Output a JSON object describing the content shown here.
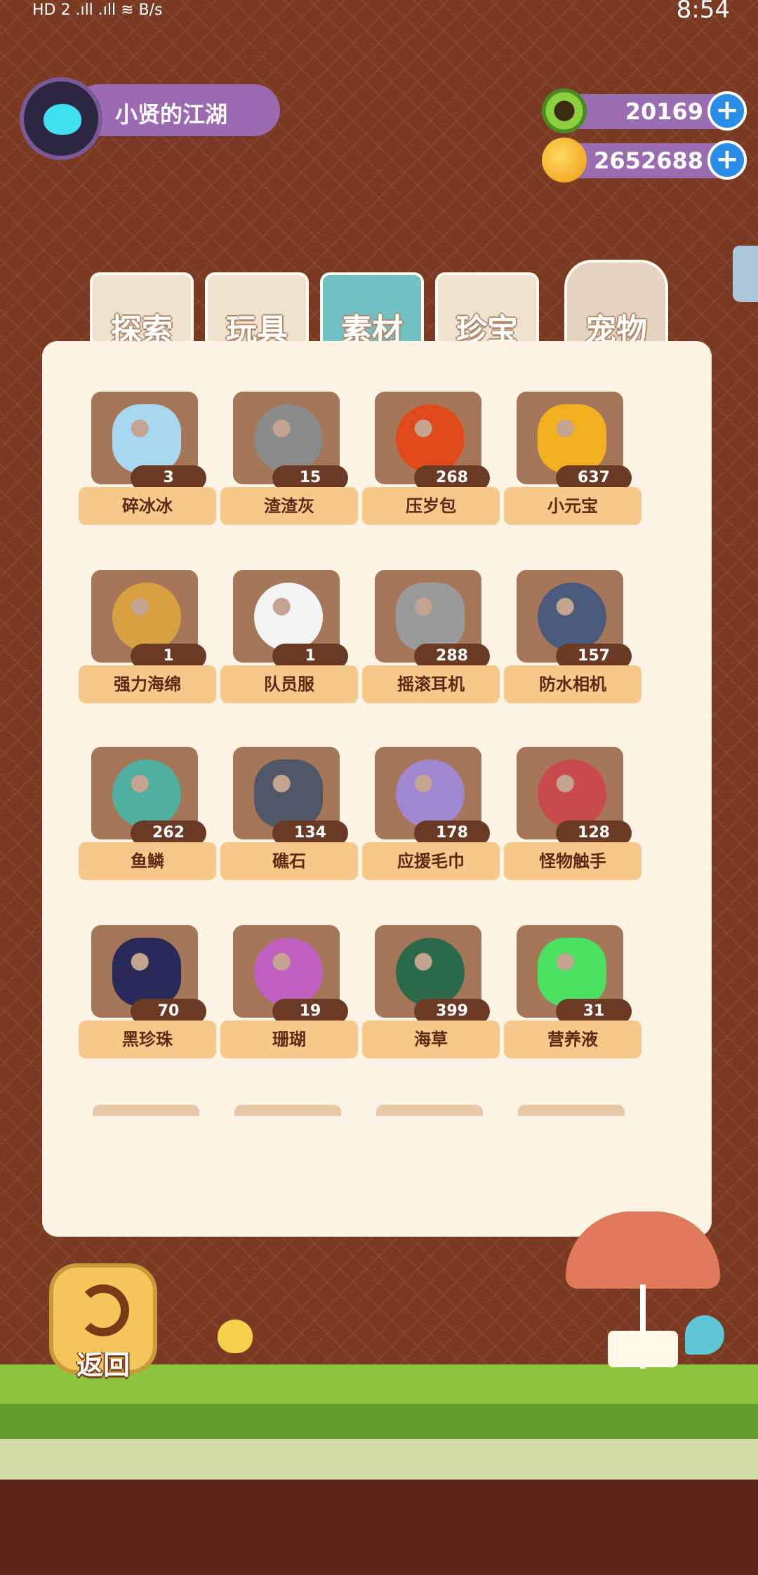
{
  "status_bar": {
    "left": "HD 2  .ıll  .ıll  ≋  B/s",
    "time": "8:54"
  },
  "profile": {
    "name": "小贤的江湖"
  },
  "currencies": [
    {
      "icon": "donut-icon",
      "value": "20169"
    },
    {
      "icon": "planet-coin-icon",
      "value": "2652688"
    }
  ],
  "tabs": [
    {
      "label": "探索",
      "active": false
    },
    {
      "label": "玩具",
      "active": false
    },
    {
      "label": "素材",
      "active": true
    },
    {
      "label": "珍宝",
      "active": false
    },
    {
      "label": "宠物",
      "active": false
    }
  ],
  "items": [
    {
      "name": "碎冰冰",
      "count": "3",
      "icon": "ice-crystal-icon",
      "color": "#a8d8f0"
    },
    {
      "name": "渣渣灰",
      "count": "15",
      "icon": "gray-rock-icon",
      "color": "#8a8a8a"
    },
    {
      "name": "压岁包",
      "count": "268",
      "icon": "red-envelope-icon",
      "color": "#e04a1a"
    },
    {
      "name": "小元宝",
      "count": "637",
      "icon": "gold-ingot-icon",
      "color": "#f2b020"
    },
    {
      "name": "强力海绵",
      "count": "1",
      "icon": "sponge-icon",
      "color": "#d8a040"
    },
    {
      "name": "队员服",
      "count": "1",
      "icon": "tshirt-icon",
      "color": "#f4f4f4"
    },
    {
      "name": "摇滚耳机",
      "count": "288",
      "icon": "headphones-icon",
      "color": "#9a9a9a"
    },
    {
      "name": "防水相机",
      "count": "157",
      "icon": "camera-icon",
      "color": "#4a5a7a"
    },
    {
      "name": "鱼鳞",
      "count": "262",
      "icon": "fish-scale-icon",
      "color": "#4fb0a0"
    },
    {
      "name": "礁石",
      "count": "134",
      "icon": "reef-rock-icon",
      "color": "#505868"
    },
    {
      "name": "应援毛巾",
      "count": "178",
      "icon": "towel-icon",
      "color": "#a088d0"
    },
    {
      "name": "怪物触手",
      "count": "128",
      "icon": "tentacle-icon",
      "color": "#c84a4a"
    },
    {
      "name": "黑珍珠",
      "count": "70",
      "icon": "black-pearl-icon",
      "color": "#2a2a5a"
    },
    {
      "name": "珊瑚",
      "count": "19",
      "icon": "coral-icon",
      "color": "#c060c0"
    },
    {
      "name": "海草",
      "count": "399",
      "icon": "seaweed-icon",
      "color": "#2a6a4a"
    },
    {
      "name": "营养液",
      "count": "31",
      "icon": "nutrient-jar-icon",
      "color": "#4ae060"
    }
  ],
  "back_button": {
    "label": "返回"
  }
}
